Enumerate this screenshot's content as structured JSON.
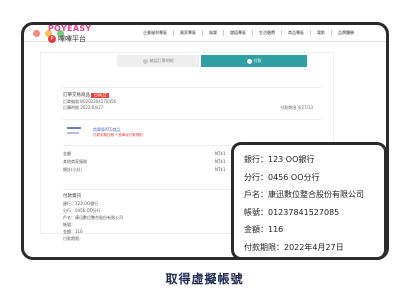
{
  "site": {
    "logo_text": "POYEASY",
    "logo_mark": "P",
    "logo_sub": "嗶嗶平台",
    "nav": [
      "企業福利專區",
      "買家專區",
      "娛樂",
      "儲值專區",
      "生活繳費",
      "商品專區",
      "電影",
      "品牌體驗"
    ]
  },
  "steps": {
    "step1": "確認訂單明細",
    "step2": "付款"
  },
  "order": {
    "title": "訂單交易商品",
    "tag": "已成立",
    "line1": "訂單編號 B0202204270456",
    "line2": "訂購時間 2022/04/27",
    "right_note": "付款期限 4/27/13"
  },
  "product": {
    "name": "首單版ATC商品",
    "tag": "付款到期日期 • 首單版付款規則"
  },
  "table": [
    {
      "label": "金額",
      "value": "NT$1"
    },
    {
      "label": "其他商家服務",
      "value": "NT$1"
    },
    {
      "label": "總計(小計)",
      "value": "NT$1"
    }
  ],
  "payment_section": {
    "head": "付款資訊",
    "lines": [
      "銀行：123 OO銀行",
      "分行：0456 OO分行",
      "戶名：康迅數位整合股份有限公司",
      "帳號：",
      "金額：116",
      "付款期限："
    ]
  },
  "popup": {
    "bank": "銀行：123 OO銀行",
    "branch": "分行：0456 OO分行",
    "account_name": "戶名：康迅數位整合股份有限公司",
    "account_number": "帳號：01237841527085",
    "amount": "金額：116",
    "deadline": "付款期限：2022年4月27日"
  },
  "caption": "取得虛擬帳號",
  "colors": {
    "accent": "#2f9fa2",
    "logo_pink": "#e8478f",
    "caption": "#1f2a52",
    "frame": "#2b2b2b"
  }
}
